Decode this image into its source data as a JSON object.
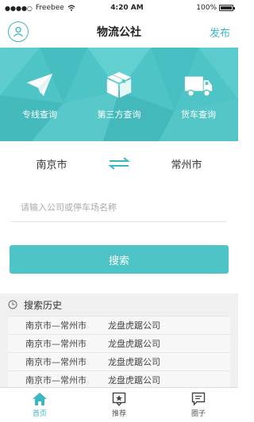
{
  "status_bar": {
    "carrier": "Freebee",
    "time": "4:20 AM",
    "battery": "100%"
  },
  "nav": {
    "title": "物流公社",
    "publish_label": "发布"
  },
  "banner": {
    "items": [
      {
        "label": "专线查询",
        "icon": "paper-plane-icon"
      },
      {
        "label": "第三方查询",
        "icon": "package-box-icon"
      },
      {
        "label": "货车查询",
        "icon": "truck-icon"
      }
    ]
  },
  "route": {
    "from_city": "南京市",
    "to_city": "常州市"
  },
  "search": {
    "placeholder": "请输入公司或停车场名称",
    "button_label": "搜索"
  },
  "history": {
    "title": "搜索历史",
    "items": [
      {
        "route": "南京市—常州市",
        "company": "龙盘虎踞公司"
      },
      {
        "route": "南京市—常州市",
        "company": "龙盘虎踞公司"
      },
      {
        "route": "南京市—常州市",
        "company": "龙盘虎踞公司"
      },
      {
        "route": "南京市—常州市",
        "company": "龙盘虎踞公司"
      }
    ]
  },
  "tabbar": {
    "tabs": [
      {
        "label": "首页",
        "icon": "home-icon"
      },
      {
        "label": "推荐",
        "icon": "recommend-icon"
      },
      {
        "label": "圈子",
        "icon": "circle-chat-icon"
      }
    ]
  },
  "colors": {
    "accent": "#4ec4c6",
    "accent_text": "#3ab7c0"
  }
}
